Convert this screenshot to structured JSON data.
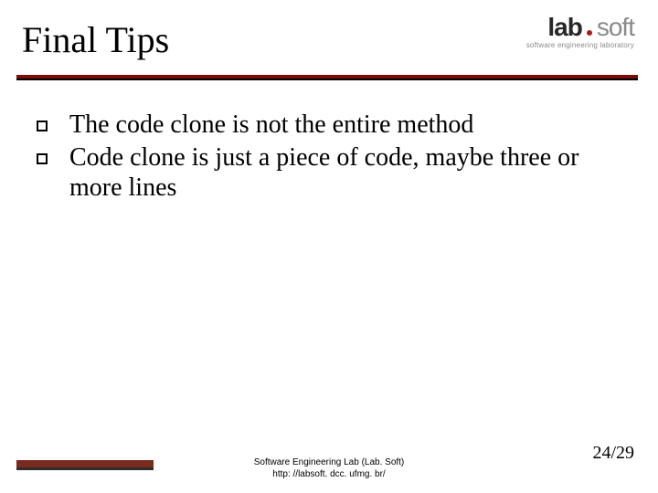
{
  "title": "Final Tips",
  "logo": {
    "lab": "lab",
    "soft": "soft",
    "subtitle": "software engineering laboratory"
  },
  "bullets": {
    "0": "The code clone is not the entire method",
    "1": "Code clone is just a piece of code, maybe three or more lines"
  },
  "footer": {
    "line1": "Software Engineering Lab (Lab. Soft)",
    "line2": "http: //labsoft. dcc. ufmg. br/",
    "page": "24/29"
  }
}
